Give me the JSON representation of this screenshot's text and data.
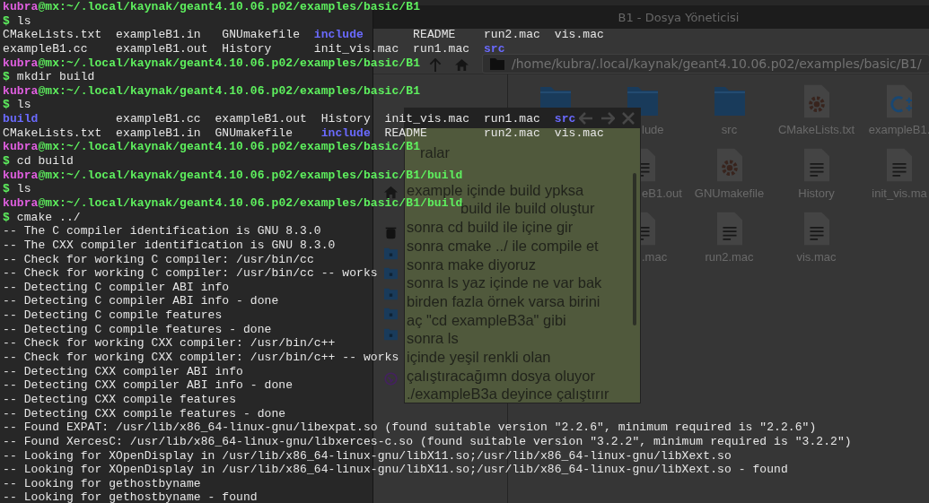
{
  "file_manager": {
    "title": "B1 - Dosya Yöneticisi",
    "address": "/home/kubra/.local/kaynak/geant4.10.06.p02/examples/basic/B1/",
    "sidebar": [
      {
        "kind": "home"
      },
      {
        "kind": "trash"
      },
      {
        "kind": "documents"
      },
      {
        "kind": "music"
      },
      {
        "kind": "pictures"
      },
      {
        "kind": "videos"
      },
      {
        "kind": "downloads"
      },
      {
        "kind": "network"
      }
    ],
    "rows": [
      [
        {
          "kind": "folder"
        },
        {
          "kind": "folder",
          "label": "lude"
        },
        {
          "kind": "folder",
          "label": "src"
        },
        {
          "kind": "settings",
          "label": "CMakeLists.txt"
        },
        {
          "kind": "source",
          "label": "exampleB1."
        }
      ],
      [
        "",
        {
          "kind": "text",
          "label": "eB1.out"
        },
        {
          "kind": "settings",
          "label": "GNUmakefile"
        },
        {
          "kind": "text",
          "label": "History"
        },
        {
          "kind": "text",
          "label": "init_vis.ma"
        }
      ],
      [
        "",
        {
          "kind": "text",
          "label": ".mac"
        },
        {
          "kind": "text",
          "label": "run2.mac"
        },
        {
          "kind": "text",
          "label": "vis.mac"
        }
      ]
    ]
  },
  "note": {
    "paragraphs": [
      [
        "ralar"
      ],
      [
        "example içinde build ypksa",
        "build ile build oluştur",
        "sonra cd build ile içine gir",
        "sonra cmake ../ ile compile et",
        "sonra make diyoruz",
        "sonra ls yaz içinde ne var bak",
        "birden fazla örnek varsa birini",
        "aç \"cd exampleB3a\" gibi",
        "sonra ls",
        "içinde yeşil renkli olan",
        "çalıştıracağımn dosya oluyor",
        "./exampleB3a  deyince çalıştırır"
      ]
    ]
  },
  "terminal": {
    "lines": [
      [
        {
          "kind": "user",
          "text": "kubra"
        },
        {
          "kind": "path",
          "text": "@mx:~/.local/kaynak/geant4.10.06.p02/examples/basic/B1"
        }
      ],
      [
        {
          "kind": "prompt",
          "text": "$ "
        },
        {
          "kind": "text",
          "text": "ls"
        }
      ],
      [
        {
          "kind": "text",
          "text": "CMakeLists.txt  exampleB1.in   GNUmakefile  "
        },
        {
          "kind": "dir",
          "text": "include"
        },
        {
          "kind": "text",
          "text": "       README    run2.mac  vis.mac"
        }
      ],
      [
        {
          "kind": "text",
          "text": "exampleB1.cc    exampleB1.out  History      init_vis.mac  run1.mac  "
        },
        {
          "kind": "dir",
          "text": "src"
        }
      ],
      [
        {
          "kind": "user",
          "text": "kubra"
        },
        {
          "kind": "path",
          "text": "@mx:~/.local/kaynak/geant4.10.06.p02/examples/basic/B1"
        }
      ],
      [
        {
          "kind": "prompt",
          "text": "$ "
        },
        {
          "kind": "text",
          "text": "mkdir build"
        }
      ],
      [
        {
          "kind": "user",
          "text": "kubra"
        },
        {
          "kind": "path",
          "text": "@mx:~/.local/kaynak/geant4.10.06.p02/examples/basic/B1"
        }
      ],
      [
        {
          "kind": "prompt",
          "text": "$ "
        },
        {
          "kind": "text",
          "text": "ls"
        }
      ],
      [
        {
          "kind": "dir",
          "text": "build"
        },
        {
          "kind": "text",
          "text": "           exampleB1.cc  exampleB1.out  History  init_vis.mac  run1.mac  "
        },
        {
          "kind": "dir",
          "text": "src"
        }
      ],
      [
        {
          "kind": "text",
          "text": "CMakeLists.txt  exampleB1.in  GNUmakefile    "
        },
        {
          "kind": "dir",
          "text": "include"
        },
        {
          "kind": "text",
          "text": "  README        run2.mac  vis.mac"
        }
      ],
      [
        {
          "kind": "user",
          "text": "kubra"
        },
        {
          "kind": "path",
          "text": "@mx:~/.local/kaynak/geant4.10.06.p02/examples/basic/B1"
        }
      ],
      [
        {
          "kind": "prompt",
          "text": "$ "
        },
        {
          "kind": "text",
          "text": "cd build"
        }
      ],
      [
        {
          "kind": "user",
          "text": "kubra"
        },
        {
          "kind": "path",
          "text": "@mx:~/.local/kaynak/geant4.10.06.p02/examples/basic/B1/build"
        }
      ],
      [
        {
          "kind": "prompt",
          "text": "$ "
        },
        {
          "kind": "text",
          "text": "ls"
        }
      ],
      [
        {
          "kind": "user",
          "text": "kubra"
        },
        {
          "kind": "path",
          "text": "@mx:~/.local/kaynak/geant4.10.06.p02/examples/basic/B1/build"
        }
      ],
      [
        {
          "kind": "prompt",
          "text": "$ "
        },
        {
          "kind": "text",
          "text": "cmake ../"
        }
      ],
      [
        {
          "kind": "text",
          "text": "-- The C compiler identification is GNU 8.3.0"
        }
      ],
      [
        {
          "kind": "text",
          "text": "-- The CXX compiler identification is GNU 8.3.0"
        }
      ],
      [
        {
          "kind": "text",
          "text": "-- Check for working C compiler: /usr/bin/cc"
        }
      ],
      [
        {
          "kind": "text",
          "text": "-- Check for working C compiler: /usr/bin/cc -- works"
        }
      ],
      [
        {
          "kind": "text",
          "text": "-- Detecting C compiler ABI info"
        }
      ],
      [
        {
          "kind": "text",
          "text": "-- Detecting C compiler ABI info - done"
        }
      ],
      [
        {
          "kind": "text",
          "text": "-- Detecting C compile features"
        }
      ],
      [
        {
          "kind": "text",
          "text": "-- Detecting C compile features - done"
        }
      ],
      [
        {
          "kind": "text",
          "text": "-- Check for working CXX compiler: /usr/bin/c++"
        }
      ],
      [
        {
          "kind": "text",
          "text": "-- Check for working CXX compiler: /usr/bin/c++ -- works"
        }
      ],
      [
        {
          "kind": "text",
          "text": "-- Detecting CXX compiler ABI info"
        }
      ],
      [
        {
          "kind": "text",
          "text": "-- Detecting CXX compiler ABI info - done"
        }
      ],
      [
        {
          "kind": "text",
          "text": "-- Detecting CXX compile features"
        }
      ],
      [
        {
          "kind": "text",
          "text": "-- Detecting CXX compile features - done"
        }
      ],
      [
        {
          "kind": "text",
          "text": "-- Found EXPAT: /usr/lib/x86_64-linux-gnu/libexpat.so (found suitable version \"2.2.6\", minimum required is \"2.2.6\")"
        }
      ],
      [
        {
          "kind": "text",
          "text": "-- Found XercesC: /usr/lib/x86_64-linux-gnu/libxerces-c.so (found suitable version \"3.2.2\", minimum required is \"3.2.2\")"
        }
      ],
      [
        {
          "kind": "text",
          "text": "-- Looking for XOpenDisplay in /usr/lib/x86_64-linux-gnu/libX11.so;/usr/lib/x86_64-linux-gnu/libXext.so"
        }
      ],
      [
        {
          "kind": "text",
          "text": "-- Looking for XOpenDisplay in /usr/lib/x86_64-linux-gnu/libX11.so;/usr/lib/x86_64-linux-gnu/libXext.so - found"
        }
      ],
      [
        {
          "kind": "text",
          "text": "-- Looking for gethostbyname"
        }
      ],
      [
        {
          "kind": "text",
          "text": "-- Looking for gethostbyname - found"
        }
      ]
    ]
  }
}
